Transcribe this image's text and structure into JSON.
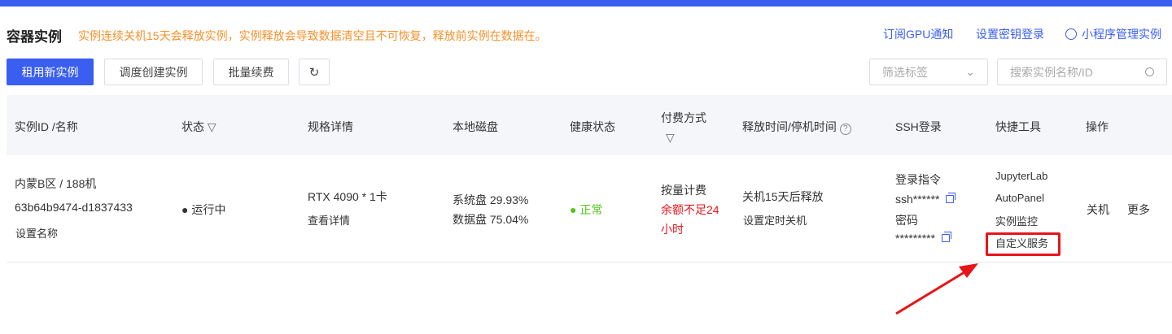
{
  "header": {
    "title": "容器实例",
    "warning": "实例连续关机15天会释放实例，实例释放会导致数据清空且不可恢复，释放前实例在数据在。",
    "links": [
      "订阅GPU通知",
      "设置密钥登录",
      "小程序管理实例"
    ]
  },
  "toolbar": {
    "rent": "租用新实例",
    "schedule": "调度创建实例",
    "renew": "批量续费",
    "filter_placeholder": "筛选标签",
    "search_placeholder": "搜索实例名称/ID"
  },
  "table": {
    "headers": [
      "实例ID /名称",
      "状态",
      "规格详情",
      "本地磁盘",
      "健康状态",
      "付费方式",
      "释放时间/停机时间",
      "SSH登录",
      "快捷工具",
      "操作"
    ],
    "row": {
      "region": "内蒙B区 / 188机",
      "id": "63b64b9474-d1837433",
      "set_name": "设置名称",
      "status": "运行中",
      "spec": "RTX 4090 * 1卡",
      "spec_detail": "查看详情",
      "disk_sys": "系统盘 29.93%",
      "disk_data": "数据盘 75.04%",
      "health": "正常",
      "pay": "按量计费",
      "pay_warn_1": "余额不足24",
      "pay_warn_2": "小时",
      "release": "关机15天后释放",
      "set_shutdown": "设置定时关机",
      "ssh_label": "登录指令",
      "ssh_cmd": "ssh******",
      "pwd_label": "密码",
      "pwd": "*********",
      "tools": [
        "JupyterLab",
        "AutoPanel",
        "实例监控",
        "自定义服务"
      ],
      "actions": [
        "关机",
        "更多"
      ]
    }
  },
  "colors": {
    "accent": "#3a5ef0",
    "warning": "#f7902a",
    "danger": "#e8141a",
    "success": "#52c41a"
  }
}
